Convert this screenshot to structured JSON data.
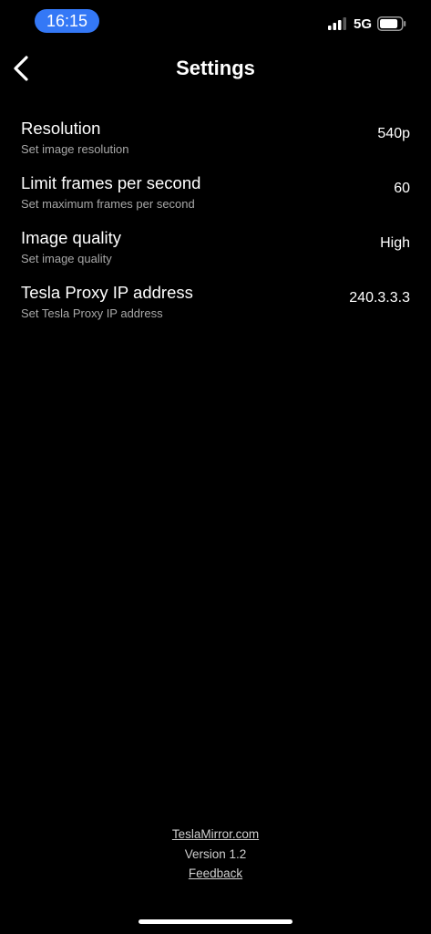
{
  "status_bar": {
    "time": "16:15",
    "network": "5G",
    "icons": [
      "signal-icon",
      "battery-icon"
    ],
    "time_pill_color": "#3478f6",
    "battery_level": 0.85
  },
  "header": {
    "title": "Settings",
    "back_icon": "chevron-left-icon"
  },
  "settings": [
    {
      "title": "Resolution",
      "subtitle": "Set image resolution",
      "value": "540p"
    },
    {
      "title": "Limit frames per second",
      "subtitle": "Set maximum frames per second",
      "value": "60"
    },
    {
      "title": "Image quality",
      "subtitle": "Set image quality",
      "value": "High"
    },
    {
      "title": "Tesla Proxy IP address",
      "subtitle": "Set Tesla Proxy IP address",
      "value": "240.3.3.3"
    }
  ],
  "footer": {
    "website_link": "TeslaMirror.com",
    "version": "Version 1.2",
    "feedback_link": "Feedback"
  },
  "colors": {
    "background": "#000000",
    "text_primary": "#ffffff",
    "text_secondary": "#a8a8a8",
    "accent": "#3478f6"
  }
}
